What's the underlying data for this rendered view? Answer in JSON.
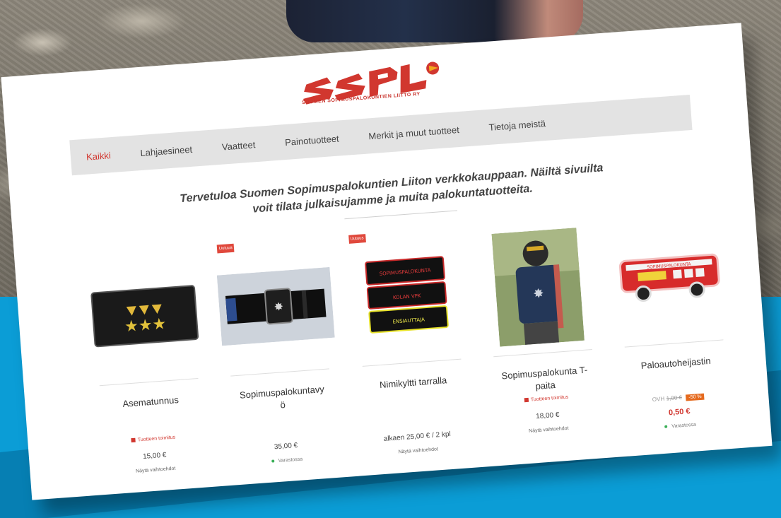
{
  "brand": {
    "logo_text": "SSPL",
    "tagline": "SUOMEN SOPIMUSPALOKUNTIEN LIITTO RY",
    "red": "#d1372f"
  },
  "nav": {
    "items": [
      {
        "label": "Kaikki",
        "active": true
      },
      {
        "label": "Lahjaesineet",
        "active": false
      },
      {
        "label": "Vaatteet",
        "active": false
      },
      {
        "label": "Painotuotteet",
        "active": false
      },
      {
        "label": "Merkit ja muut tuotteet",
        "active": false
      },
      {
        "label": "Tietoja meistä",
        "active": false
      }
    ]
  },
  "welcome": {
    "line1": "Tervetuloa Suomen Sopimuspalokuntien Liiton verkkokauppaan. Näiltä sivuilta",
    "line2": "voit tilata julkaisujamme ja muita palokuntatuotteita."
  },
  "products": [
    {
      "name": "Asematunnus",
      "badge": "",
      "delivery": "Tuotteen toimitus",
      "price": "15,00 €",
      "options": "Näytä vaihtoehdot"
    },
    {
      "name": "Sopimuspalokuntavyö",
      "badge": "Uutuus",
      "stock": "Varastossa",
      "price": "35,00 €"
    },
    {
      "name": "Nimikyltti tarralla",
      "badge": "Uutuus",
      "price": "alkaen 25,00 € / 2 kpl",
      "options": "Näytä vaihtoehdot",
      "patch_lines": [
        "SOPIMUSPALOKUNTA",
        "KOLAN VPK",
        "ENSIAUTTAJA"
      ]
    },
    {
      "name": "Sopimuspalokunta T-paita",
      "badge": "",
      "delivery": "Tuotteen toimitus",
      "price": "18,00 €",
      "options": "Näytä vaihtoehdot"
    },
    {
      "name": "Paloautoheijastin",
      "badge": "",
      "price_prefix": "OVH",
      "price_old": "1,00 €",
      "discount": "-50 %",
      "price": "0,50 €",
      "stock": "Varastossa",
      "truck_text": "SOPIMUSPALOKUNTA"
    }
  ],
  "colors": {
    "blue_bg": "#0b9dd6",
    "nav_bg": "#e3e3e3",
    "discount": "#e56a1e",
    "stock_dot": "#3aaf57"
  }
}
